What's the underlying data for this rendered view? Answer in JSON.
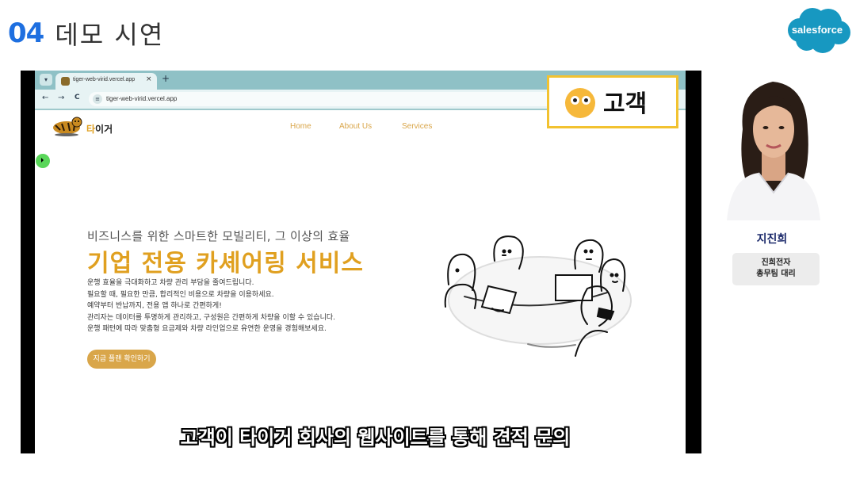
{
  "slide": {
    "number": "04",
    "title": "데모 시연"
  },
  "brand": {
    "logo_text": "salesforce",
    "logo_color": "#1798c1",
    "accent_blue": "#1e6fe0"
  },
  "browser": {
    "tab_title": "tiger-web-virid.vercel.app",
    "tab_close": "×",
    "new_tab": "+",
    "url": "tiger-web-virid.vercel.app",
    "back": "←",
    "forward": "→",
    "reload": "C"
  },
  "website": {
    "logo_name_accent": "타",
    "logo_name_rest": "이거",
    "nav": [
      "Home",
      "About Us",
      "Services"
    ],
    "hero_subtitle": "비즈니스를 위한 스마트한 모빌리티, 그 이상의 효율",
    "hero_title": "기업 전용 카셰어링 서비스",
    "hero_desc": [
      "운행 효율을 극대화하고 차량 관리 부담을 줄여드립니다.",
      "필요할 때, 필요한 만큼, 합리적인 비용으로 차량을 이용하세요.",
      "예약부터 반납까지, 전용 앱 하나로 간편하게!",
      "관리자는 데이터를 투명하게 관리하고, 구성원은 간편하게 차량을 이할 수 있습니다.",
      "운행 패턴에 따라 맞춤형 요금제와 차량 라인업으로 유연한 운영을 경험해보세요."
    ],
    "cta_label": "지금 플랜 확인하기",
    "accent_color": "#e0a020"
  },
  "role_badge": {
    "label": "고객",
    "border_color": "#f2c230"
  },
  "caption": "고객이 타이거 회사의 웹사이트를 통해 견적 문의",
  "presenter": {
    "name": "지진희",
    "company": "진희전자",
    "position": "총무팀 대리"
  }
}
